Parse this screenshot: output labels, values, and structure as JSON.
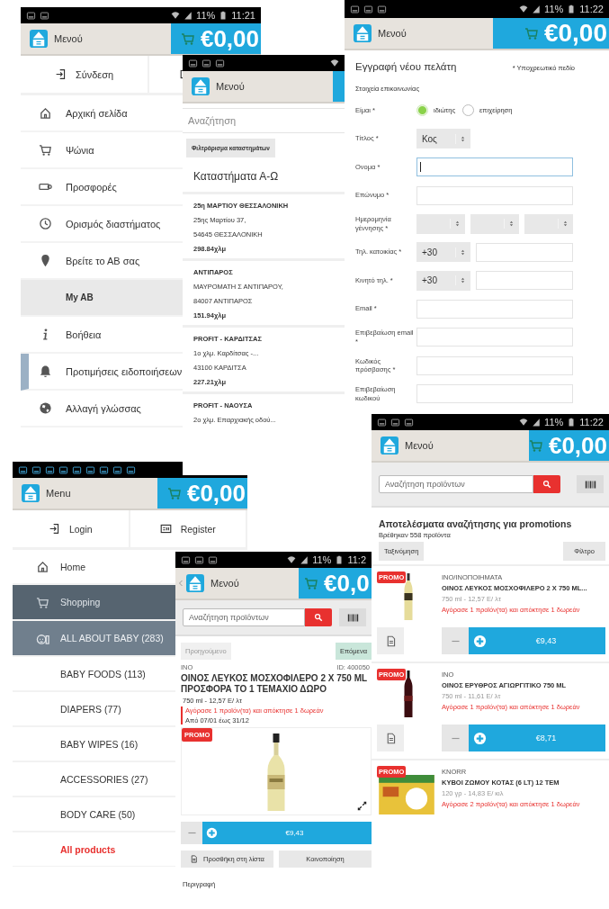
{
  "screens": [
    {
      "kind": "menu",
      "status_bar": {
        "battery": "11%",
        "time": "11:21"
      },
      "header": {
        "title": "Μενού",
        "cart_total": "€0,00"
      },
      "login": "Σύνδεση",
      "items": [
        {
          "label": "Αρχική σελίδα",
          "selected": false,
          "focused": false
        },
        {
          "label": "Ψώνια",
          "selected": false,
          "focused": false
        },
        {
          "label": "Προσφορές",
          "selected": false,
          "focused": false
        },
        {
          "label": "Ορισμός διαστήματος",
          "selected": false,
          "focused": false
        },
        {
          "label": "Βρείτε το ΑΒ σας",
          "selected": false,
          "focused": false
        },
        {
          "label": "My AB",
          "selected": true,
          "focused": false
        },
        {
          "label": "Βοήθεια",
          "selected": false,
          "focused": false
        },
        {
          "label": "Προτιμήσεις ειδοποιήσεων",
          "selected": false,
          "focused": true
        },
        {
          "label": "Αλλαγή γλώσσας",
          "selected": false,
          "focused": false
        }
      ]
    },
    {
      "kind": "stores",
      "header": {
        "title": "Μενού"
      },
      "search": {
        "placeholder": "Αναζήτηση"
      },
      "filter_button": "Φιλτράρισμα καταστημάτων",
      "heading": "Καταστήματα Α-Ω",
      "stores": [
        {
          "name": "25η ΜΑΡΤΙΟΥ ΘΕΣΣΑΛΟΝΙΚΗ",
          "address": "25ης Μαρτίου 37,",
          "city": "54645 ΘΕΣΣΑΛΟΝΙΚΗ",
          "distance": "298.84χλμ"
        },
        {
          "name": "ΑΝΤΙΠΑΡΟΣ",
          "address": "ΜΑΥΡΟΜΑΤΗ Σ ΑΝΤΙΠΑΡΟΥ,",
          "city": "84007 ΑΝΤΙΠΑΡΟΣ",
          "distance": "151.94χλμ"
        },
        {
          "name": "PROFIT - ΚΑΡΔΙΤΣΑΣ",
          "address": "1ο χλμ. Καρδίτσας -...",
          "city": "43100 ΚΑΡΔΙΤΣΑ",
          "distance": "227.21χλμ"
        },
        {
          "name": "PROFIT - ΝΑΟΥΣΑ",
          "address": "2ο χλμ. Επαρχιακής οδού..."
        }
      ]
    },
    {
      "kind": "registration",
      "status_bar": {
        "battery": "11%",
        "time": "11:22"
      },
      "header": {
        "title": "Μενού",
        "cart_total": "€0,00"
      },
      "title": "Εγγραφή νέου πελάτη",
      "note": "* Υποχρεωτικό πεδίο",
      "section": "Στοιχεία επικοινωνίας",
      "fields": [
        {
          "kind": "radio",
          "label": "Είμαι *",
          "options": [
            {
              "label": "ιδιώτης",
              "selected": true
            },
            {
              "label": "επιχείρηση",
              "selected": false
            }
          ]
        },
        {
          "kind": "select",
          "label": "Τίτλος *",
          "value": "Κος"
        },
        {
          "kind": "text",
          "label": "Ονομα *",
          "focused": true
        },
        {
          "kind": "text",
          "label": "Επώνυμο *",
          "focused": false
        },
        {
          "kind": "date",
          "label": "Ημερομηνία γέννησης *"
        },
        {
          "kind": "phone",
          "label": "Τηλ. κατοικίας *",
          "code": "+30"
        },
        {
          "kind": "phone",
          "label": "Κινητό τηλ. *",
          "code": "+30"
        },
        {
          "kind": "text",
          "label": "Email *",
          "focused": false
        },
        {
          "kind": "text",
          "label": "Επιβεβαίωση email *",
          "focused": false
        },
        {
          "kind": "text",
          "label": "Κωδικός πρόσβασης *",
          "focused": false
        },
        {
          "kind": "text",
          "label": "Επιβεβαίωση κωδικού",
          "focused": false
        }
      ]
    },
    {
      "kind": "category_menu",
      "header": {
        "title": "Menu",
        "cart_total": "€0,00"
      },
      "login": "Login",
      "register": "Register",
      "items": [
        {
          "kind": "nav",
          "label": "Home",
          "selected": false
        },
        {
          "kind": "nav",
          "label": "Shopping",
          "selected": true
        },
        {
          "kind": "category",
          "label": "ALL ABOUT BABY (283)",
          "selected": false
        },
        {
          "kind": "subcategory",
          "label": "BABY FOODS (113)",
          "selected": false
        },
        {
          "kind": "subcategory",
          "label": "DIAPERS (77)",
          "selected": false
        },
        {
          "kind": "subcategory",
          "label": "BABY WIPES (16)",
          "selected": false
        },
        {
          "kind": "subcategory",
          "label": "ACCESSORIES (27)",
          "selected": false
        },
        {
          "kind": "subcategory",
          "label": "BODY CARE (50)",
          "selected": false
        },
        {
          "kind": "link",
          "label": "All products",
          "selected": false
        }
      ]
    },
    {
      "kind": "product",
      "status_bar": {
        "battery": "11%",
        "time": "11:2"
      },
      "header": {
        "back": true,
        "title": "Μενού",
        "cart_total": "€0,0"
      },
      "search": {
        "placeholder": "Αναζήτηση προϊόντων"
      },
      "prev": {
        "label": "Προηγούμενο",
        "disabled": true
      },
      "next": {
        "label": "Επόμενα",
        "disabled": false
      },
      "brand": "ΙΝΟ",
      "id": "ID: 400050",
      "name": "ΟΙΝΟΣ ΛΕΥΚΟΣ ΜΟΣΧΟΦΙΛΕΡΟ 2 Χ 750 ML ΠΡΟΣΦΟΡΑ ΤΟ 1 ΤΕΜΑΧΙΟ ΔΩΡΟ",
      "unit_price": "750 ml - 12,57 E/ λτ",
      "offer": "Αγόρασε 1 προϊόν(τα) και απόκτησε 1 δωρεάν",
      "validity": "Από 07/01 έως 31/12",
      "badge": "PROMO",
      "price": "€9,43",
      "add_to_list": "Προσθήκη στη λίστα",
      "share": "Κοινοποίηση",
      "description": "Περιγραφή"
    },
    {
      "kind": "results",
      "status_bar": {
        "battery": "11%",
        "time": "11:22"
      },
      "header": {
        "title": "Μενού",
        "cart_total": "€0,00"
      },
      "search": {
        "placeholder": "Αναζήτηση προϊόντων"
      },
      "heading": "Αποτελέσματα αναζήτησης για promotions",
      "count": "Βρέθηκαν 558 προϊόντα",
      "sort": "Ταξινόμηση",
      "filter": "Φίλτρο",
      "products": [
        {
          "badge": "PROMO",
          "category": "ΙΝΟ/ΙΝΟΠΟΙΗΜΑΤΑ",
          "name": "ΟΙΝΟΣ ΛΕΥΚΟΣ ΜΟΣΧΟΦΙΛΕΡΟ 2 Χ 750 ML...",
          "unit_price": "750 ml - 12,57 E/ λτ",
          "offer": "Αγόρασε 1 προϊόν(τα) και απόκτησε 1 δωρεάν",
          "price": "€9,43"
        },
        {
          "badge": "PROMO",
          "category": "ΙΝΟ",
          "name": "ΟΙΝΟΣ ΕΡΥΘΡΟΣ ΑΓΙΩΡΓΙΤΙΚΟ 750 ML",
          "unit_price": "750 ml - 11,61 E/ λτ",
          "offer": "Αγόρασε 1 προϊόν(τα) και απόκτησε 1 δωρεάν",
          "price": "€8,71"
        },
        {
          "badge": "PROMO",
          "category": "KNORR",
          "name": "ΚΥΒΟΙ ΖΩΜΟΥ ΚΟΤΑΣ (6 LT) 12 TEM",
          "unit_price": "120 γρ - 14,83 E/ κιλ",
          "offer": "Αγόρασε 2 προϊόν(τα) και απόκτησε 1 δωρεάν"
        }
      ]
    }
  ]
}
